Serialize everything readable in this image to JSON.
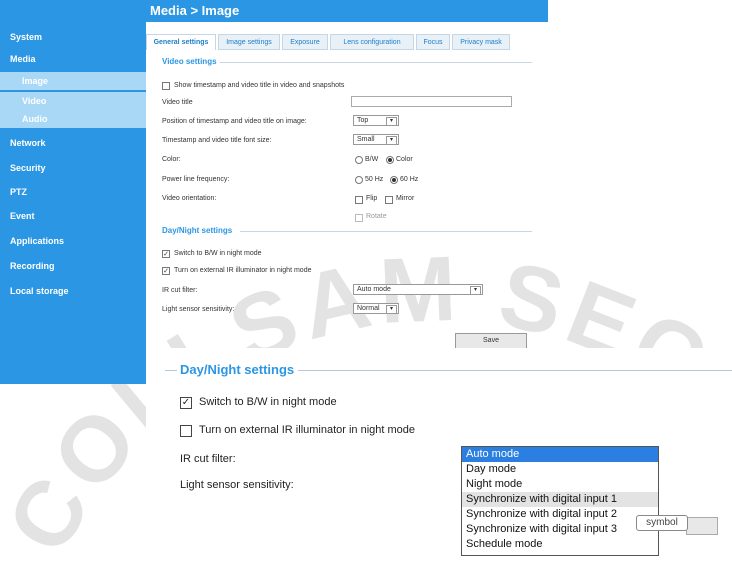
{
  "header": {
    "title": "Media  > Image"
  },
  "sidebar": {
    "items": [
      {
        "label": "System"
      },
      {
        "label": "Media"
      },
      {
        "label": "Network"
      },
      {
        "label": "Security"
      },
      {
        "label": "PTZ"
      },
      {
        "label": "Event"
      },
      {
        "label": "Applications"
      },
      {
        "label": "Recording"
      },
      {
        "label": "Local storage"
      }
    ],
    "subitems": [
      {
        "label": "Image"
      },
      {
        "label": "Video"
      },
      {
        "label": "Audio"
      }
    ]
  },
  "tabs": [
    {
      "label": "General settings"
    },
    {
      "label": "Image settings"
    },
    {
      "label": "Exposure"
    },
    {
      "label": "Lens configuration"
    },
    {
      "label": "Focus"
    },
    {
      "label": "Privacy mask"
    }
  ],
  "video_settings": {
    "title": "Video settings",
    "timestamp_checkbox": "Show timestamp and video title in video and snapshots",
    "video_title_label": "Video title",
    "video_title_value": "",
    "position_label": "Position of timestamp and video title on image:",
    "position_value": "Top",
    "font_size_label": "Timestamp and video title font size:",
    "font_size_value": "Small",
    "color_label": "Color:",
    "color_options": [
      "B/W",
      "Color"
    ],
    "power_label": "Power line frequency:",
    "power_options": [
      "50 Hz",
      "60 Hz"
    ],
    "orientation_label": "Video orientation:",
    "orientation_options": [
      "Flip",
      "Mirror",
      "Rotate"
    ]
  },
  "day_night_small": {
    "title": "Day/Night settings",
    "switch_bw": "Switch to B/W in night mode",
    "ir_illuminator": "Turn on external IR illuminator in night mode",
    "ir_cut_label": "IR cut filter:",
    "ir_cut_value": "Auto mode",
    "light_label": "Light sensor sensitivity:",
    "light_value": "Normal",
    "save_label": "Save"
  },
  "day_night_zoom": {
    "title": "Day/Night settings",
    "switch_bw": "Switch to B/W in night mode",
    "ir_illuminator": "Turn on external IR illuminator in night mode",
    "ir_cut_label": "IR cut filter:",
    "light_label": "Light sensor sensitivity:",
    "dropdown_options": [
      "Auto mode",
      "Day mode",
      "Night mode",
      "Synchronize with digital input 1",
      "Synchronize with digital input 2",
      "Synchronize with digital input 3",
      "Schedule mode"
    ],
    "tooltip": "symbol"
  },
  "watermark": "COLLSAM SECURI",
  "colors": {
    "accent": "#2b96e3",
    "selected": "#2b7fe0"
  }
}
